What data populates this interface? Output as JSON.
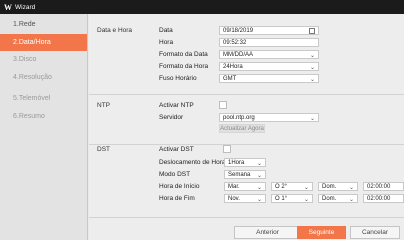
{
  "window": {
    "logo": "W",
    "title": "Wizard"
  },
  "sidebar": {
    "items": [
      {
        "label": "1.Rede"
      },
      {
        "label": "2.Data/Hora"
      },
      {
        "label": "3.Disco"
      },
      {
        "label": "4.Resolução"
      },
      {
        "label": "5.Telemóvel"
      },
      {
        "label": "6.Resumo"
      }
    ],
    "active_index": 1
  },
  "datetime": {
    "section": "Data e Hora",
    "date_label": "Data",
    "date_value": "09/18/2019",
    "time_label": "Hora",
    "time_value": "09:52:32",
    "date_format_label": "Formato da Data",
    "date_format_value": "MM/DD/AA",
    "time_format_label": "Formato da Hora",
    "time_format_value": "24Hora",
    "timezone_label": "Fuso Horário",
    "timezone_value": "GMT"
  },
  "ntp": {
    "section": "NTP",
    "enable_label": "Activar NTP",
    "server_label": "Servidor",
    "server_value": "pool.ntp.org",
    "update_button": "Actualizar Agora"
  },
  "dst": {
    "section": "DST",
    "enable_label": "Activar DST",
    "offset_label": "Deslocamento de Hora",
    "offset_value": "1Hora",
    "mode_label": "Modo DST",
    "mode_value": "Semana",
    "start_label": "Hora de Início",
    "start_month": "Mar.",
    "start_week": "O 2°",
    "start_day": "Dom.",
    "start_time": "02:00:00",
    "end_label": "Hora de Fim",
    "end_month": "Nov.",
    "end_week": "O 1°",
    "end_day": "Dom.",
    "end_time": "02:00:00"
  },
  "footer": {
    "previous": "Anterior",
    "next": "Seguinte",
    "cancel": "Cancelar"
  },
  "colors": {
    "accent": "#f2764a",
    "titlebar": "#1b1b1b"
  }
}
